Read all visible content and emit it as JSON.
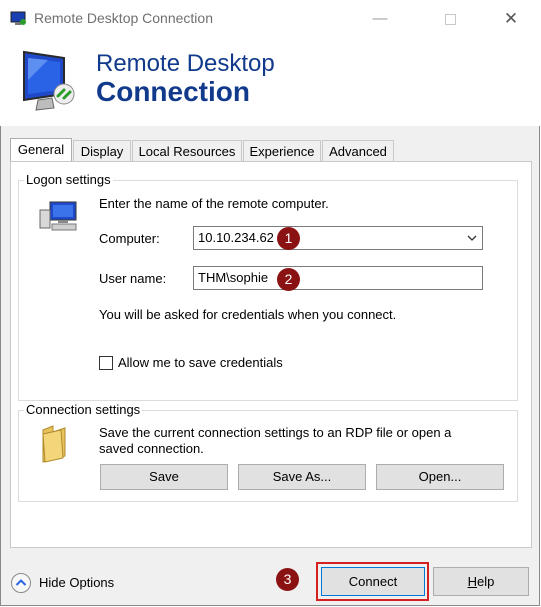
{
  "window": {
    "title": "Remote Desktop Connection",
    "banner_line1": "Remote Desktop",
    "banner_line2": "Connection"
  },
  "tabs": [
    {
      "label": "General",
      "active": true
    },
    {
      "label": "Display",
      "active": false
    },
    {
      "label": "Local Resources",
      "active": false
    },
    {
      "label": "Experience",
      "active": false
    },
    {
      "label": "Advanced",
      "active": false
    }
  ],
  "logon": {
    "group_label": "Logon settings",
    "instruction": "Enter the name of the remote computer.",
    "computer_label": "Computer:",
    "computer_value": "10.10.234.62",
    "username_label": "User name:",
    "username_value": "THM\\sophie",
    "credentials_note": "You will be asked for credentials when you connect.",
    "save_credentials_label": "Allow me to save credentials",
    "save_credentials_checked": false
  },
  "connection": {
    "group_label": "Connection settings",
    "description_line1": "Save the current connection settings to an RDP file or open a",
    "description_line2": "saved connection.",
    "save_label": "Save",
    "save_as_label": "Save As...",
    "open_label": "Open..."
  },
  "footer": {
    "hide_options_label": "Hide Options",
    "connect_label": "Connect",
    "help_label": "Help",
    "help_underline": "H",
    "help_rest": "elp"
  },
  "annotations": {
    "badge1": "1",
    "badge2": "2",
    "badge3": "3",
    "badge_color": "#8b1212",
    "highlight_color": "#d42020"
  }
}
